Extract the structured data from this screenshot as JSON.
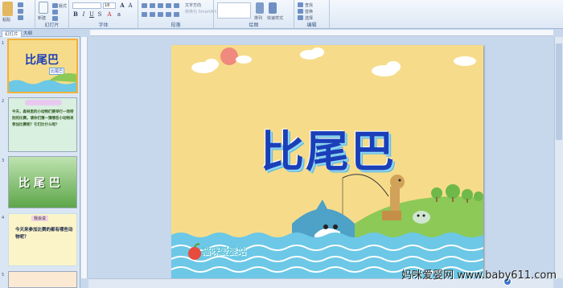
{
  "ribbon": {
    "groups": [
      {
        "id": "clipboard",
        "label": ""
      },
      {
        "id": "slides",
        "label": "幻灯片"
      },
      {
        "id": "font",
        "label": "字体"
      },
      {
        "id": "paragraph",
        "label": "段落"
      },
      {
        "id": "drawing",
        "label": "绘图"
      },
      {
        "id": "editing",
        "label": "编辑"
      }
    ],
    "clipboard_paste": "粘贴",
    "slides_new": "新建",
    "slides_layout": "版式",
    "font_size": "18",
    "text_direction": "文字方向",
    "smartart": "转换为 SmartArt",
    "arrange": "排列",
    "quick_styles": "快速样式",
    "find": "查找",
    "replace": "替换",
    "select": "选择"
  },
  "left_panel": {
    "tabs": [
      "幻灯片",
      "大纲"
    ],
    "thumbnails": [
      {
        "num": "1",
        "title": "比尾巴",
        "subtitle": "比尾巴"
      },
      {
        "num": "2",
        "text": "今天，森林里的小动物们要举行一场特别的比赛。请你们猜一猜哪些小动物来参加比赛呢？它们比什么呢？"
      },
      {
        "num": "3",
        "title": "比 尾 巴"
      },
      {
        "num": "4",
        "badge": "我会说",
        "text": "今天来参加比赛的都有哪些动物呢？"
      },
      {
        "num": "5"
      }
    ]
  },
  "slide": {
    "title": "比尾巴",
    "logo_text": "猫咪爱婴站"
  },
  "watermark": "妈咪爱婴网 www.baby611.com",
  "colors": {
    "slide_bg": "#f6dc8a",
    "title_blue": "#1b3fb8",
    "water": "#6cc8e6",
    "grass": "#8dc957"
  }
}
